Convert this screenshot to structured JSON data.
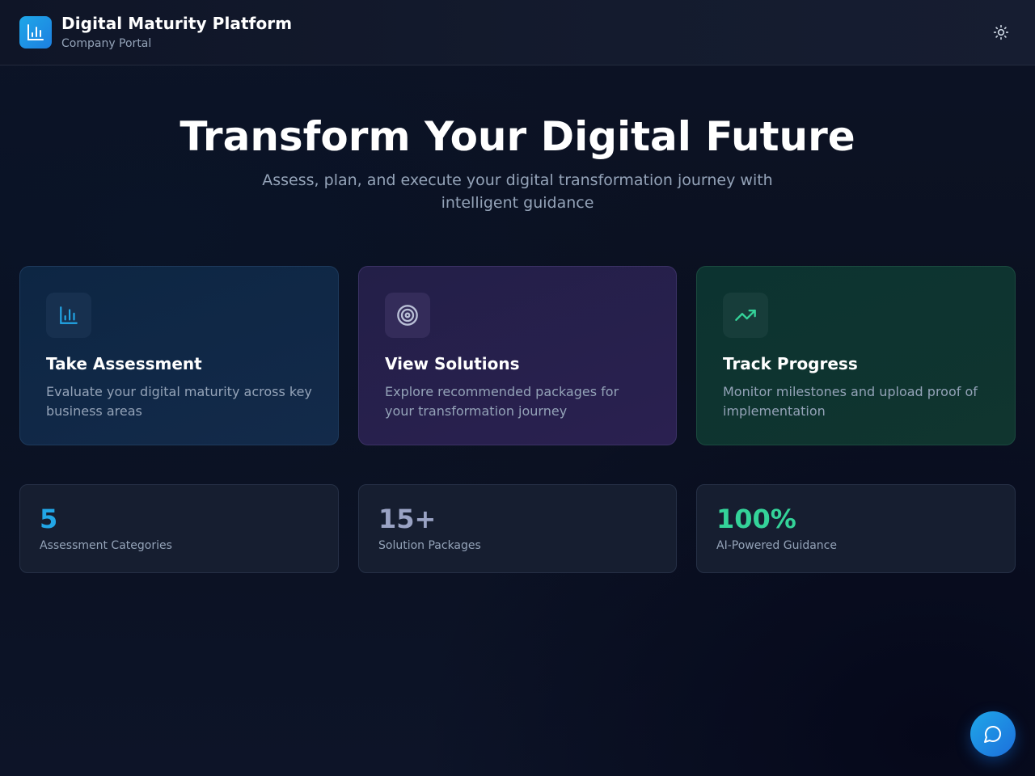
{
  "header": {
    "title": "Digital Maturity Platform",
    "subtitle": "Company Portal",
    "logo_icon": "bar-chart-icon",
    "theme_toggle_icon": "sun-icon"
  },
  "hero": {
    "title": "Transform Your Digital Future",
    "subtitle": "Assess, plan, and execute your digital transformation journey with intelligent guidance"
  },
  "cards": [
    {
      "title": "Take Assessment",
      "description": "Evaluate your digital maturity across key business areas",
      "icon": "bar-chart-icon",
      "accent": "#22a6e6"
    },
    {
      "title": "View Solutions",
      "description": "Explore recommended packages for your transformation journey",
      "icon": "target-icon",
      "accent": "#b9bfd6"
    },
    {
      "title": "Track Progress",
      "description": "Monitor milestones and upload proof of implementation",
      "icon": "trending-up-icon",
      "accent": "#34d399"
    }
  ],
  "stats": [
    {
      "value": "5",
      "label": "Assessment Categories",
      "color": "#22a6e6"
    },
    {
      "value": "15+",
      "label": "Solution Packages",
      "color": "#9aa3c4"
    },
    {
      "value": "100%",
      "label": "AI-Powered Guidance",
      "color": "#34d399"
    }
  ],
  "chat_fab": {
    "icon": "chat-bubble-icon"
  },
  "colors": {
    "background": "#0b1120",
    "brand": "#1ea7e8",
    "muted_text": "#94a3b8"
  }
}
